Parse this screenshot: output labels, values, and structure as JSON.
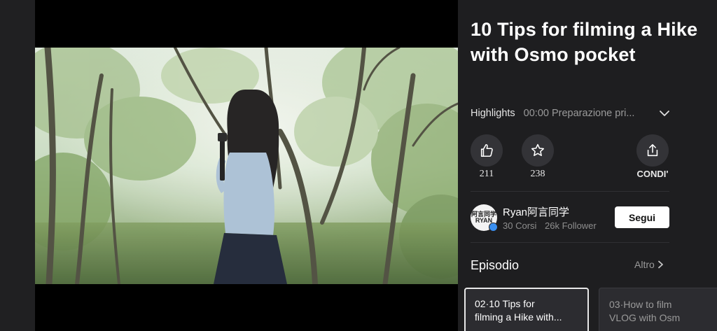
{
  "video": {
    "title": "10 Tips for filming a Hike with Osmo pocket"
  },
  "highlights": {
    "label": "Highlights",
    "text": "00:00 Preparazione pri..."
  },
  "actions": {
    "like_count": "211",
    "favorite_count": "238",
    "share_label": "CONDI'"
  },
  "creator": {
    "avatar_text": "阿言同学 RYAN",
    "name": "Ryan阿言同学",
    "courses": "30 Corsi",
    "followers": "26k Follower",
    "follow_label": "Segui"
  },
  "episodes": {
    "title": "Episodio",
    "more_label": "Altro",
    "items": [
      {
        "line1": "02·10 Tips for",
        "line2": "filming a Hike with..."
      },
      {
        "line1": "03·How to film",
        "line2": "VLOG with Osm"
      }
    ]
  },
  "colors": {
    "background": "#202022",
    "panel": "#1e1e20",
    "button_circle": "#333337",
    "follow_button": "#ffffff",
    "verified_badge": "#3a8ff0"
  }
}
